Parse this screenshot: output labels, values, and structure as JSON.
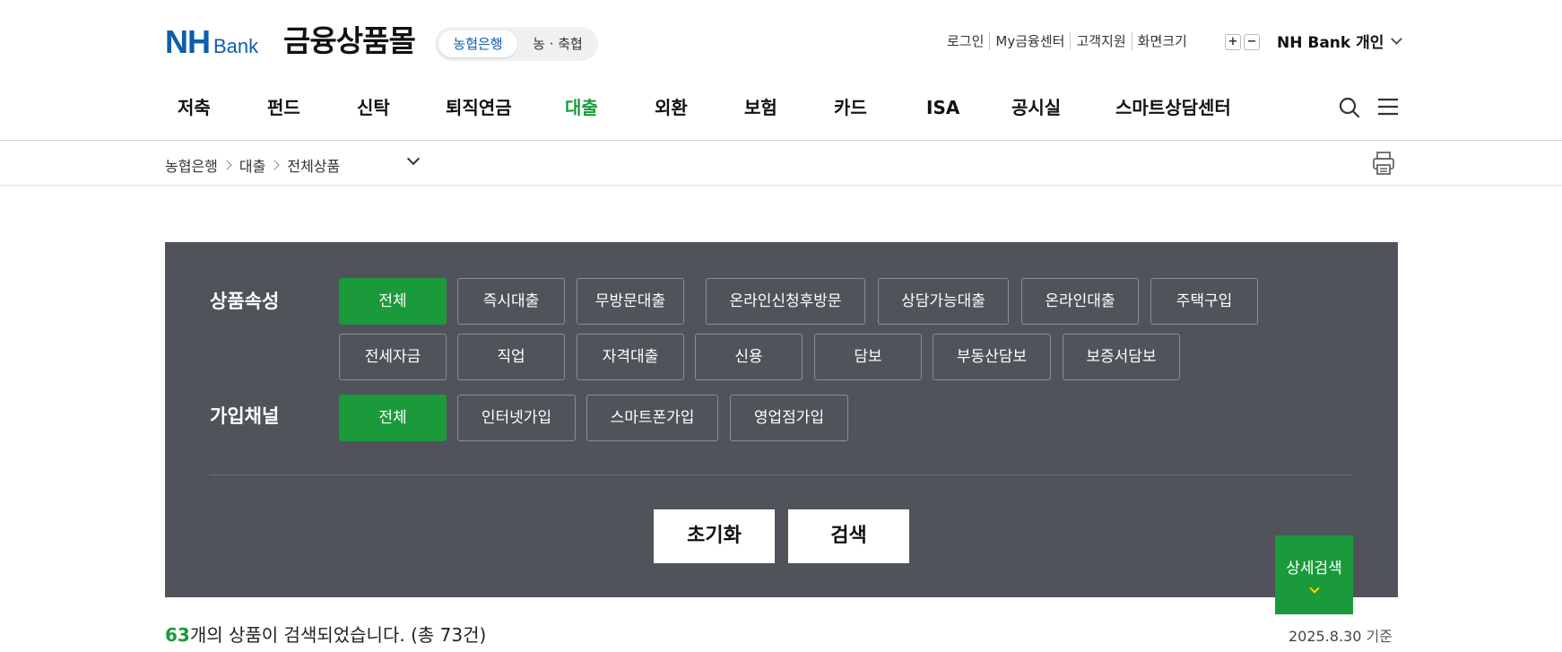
{
  "header": {
    "logo_nh": "NH",
    "logo_bank": "Bank",
    "mall_title": "금융상품몰",
    "switch": {
      "active": "농협은행",
      "other": "농 · 축협"
    },
    "util_links": [
      "로그인",
      "My금융센터",
      "고객지원",
      "화면크기"
    ],
    "zoom_plus": "+",
    "zoom_minus": "−",
    "site_selector": "NH Bank 개인"
  },
  "gnb": {
    "items": [
      "저축",
      "펀드",
      "신탁",
      "퇴직연금",
      "대출",
      "외환",
      "보험",
      "카드",
      "ISA",
      "공시실",
      "스마트상담센터"
    ],
    "active": "대출"
  },
  "breadcrumb": [
    "농협은행",
    "대출",
    "전체상품"
  ],
  "filters": {
    "attr_label": "상품속성",
    "attr_chips": [
      "전체",
      "즉시대출",
      "무방문대출",
      "온라인신청후방문",
      "상담가능대출",
      "온라인대출",
      "주택구입",
      "전세자금",
      "직업",
      "자격대출",
      "신용",
      "담보",
      "부동산담보",
      "보증서담보"
    ],
    "channel_label": "가입채널",
    "channel_chips": [
      "전체",
      "인터넷가입",
      "스마트폰가입",
      "영업점가입"
    ],
    "reset_label": "초기화",
    "search_label": "검색",
    "detail_label": "상세검색"
  },
  "result": {
    "count": "63",
    "text": "개의 상품이 검색되었습니다. (총 73건)",
    "date": "2025.8.30",
    "date_suffix": " 기준"
  },
  "colors": {
    "brand_blue": "#0b5fad",
    "accent_green": "#1b9a3c",
    "panel_bg": "#50535a",
    "detail_chevron": "#f3d400"
  }
}
